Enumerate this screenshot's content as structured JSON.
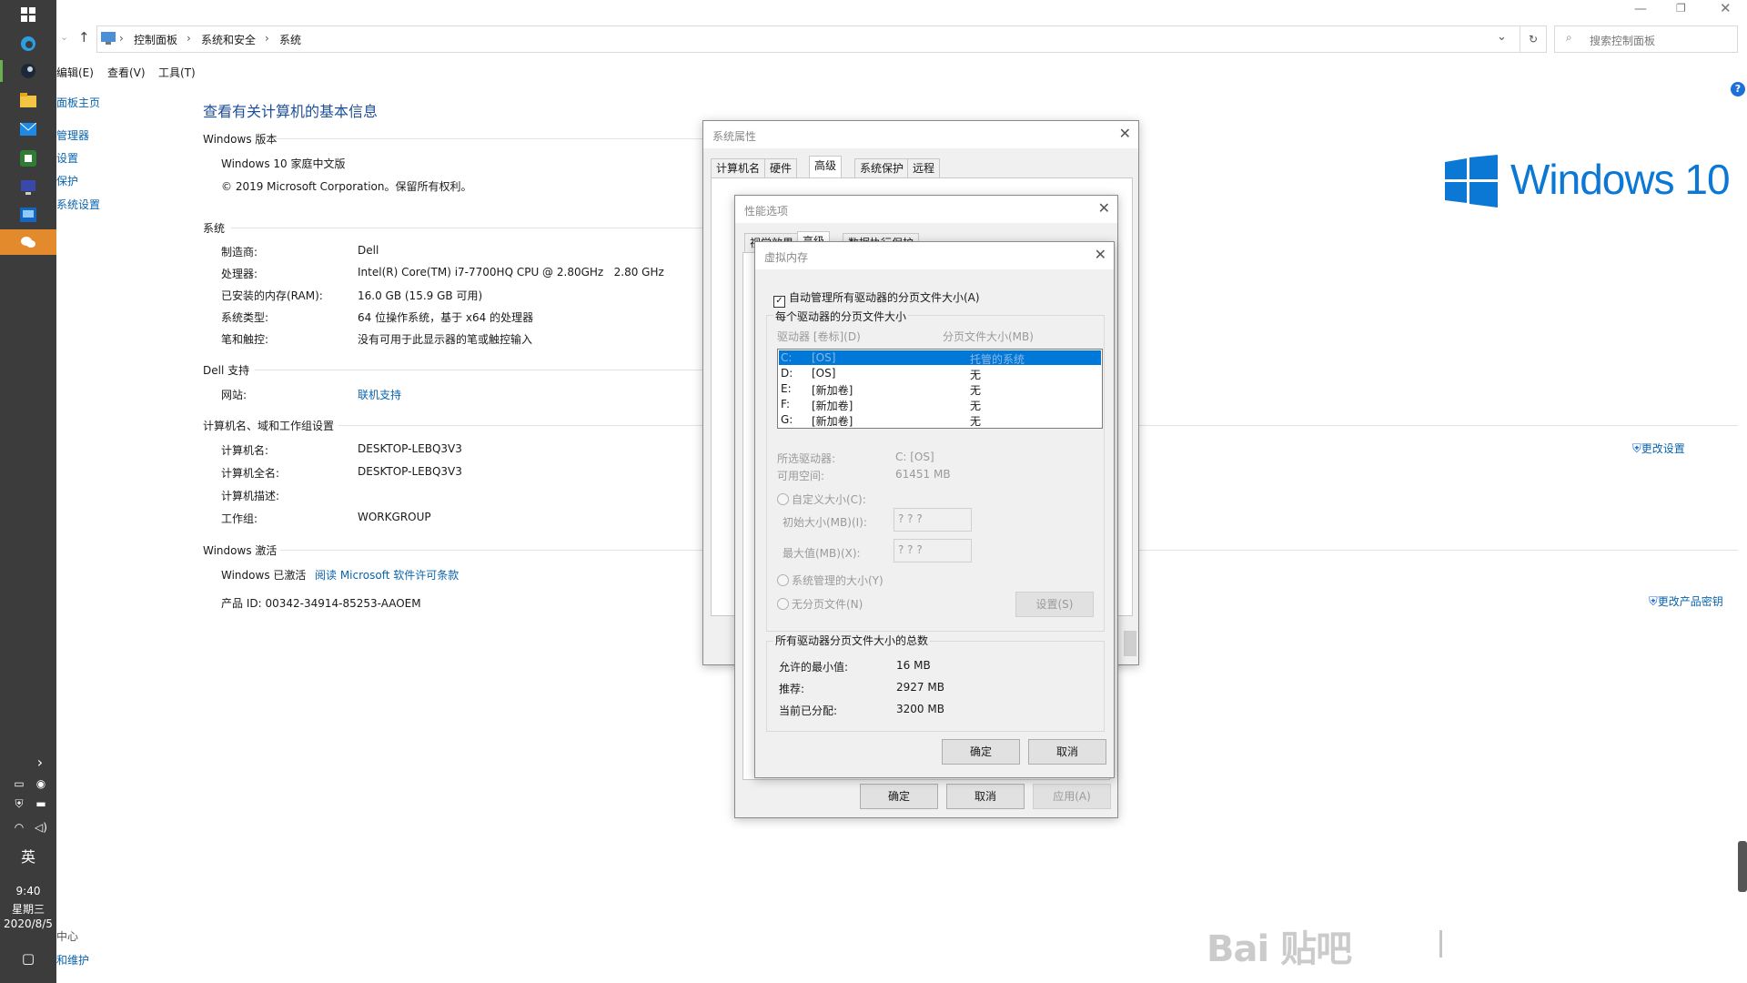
{
  "taskbar": {
    "lang": "英",
    "time": "9:40",
    "weekday": "星期三",
    "date": "2020/8/5"
  },
  "window": {
    "breadcrumb": [
      "控制面板",
      "系统和安全",
      "系统"
    ],
    "search_placeholder": "搜索控制面板",
    "menu": [
      "编辑(E)",
      "查看(V)",
      "工具(T)"
    ]
  },
  "left_nav": [
    "面板主页",
    "管理器",
    "设置",
    "保护",
    "系统设置"
  ],
  "left_nav_bottom": [
    "中心",
    "和维护"
  ],
  "main": {
    "title": "查看有关计算机的基本信息",
    "edition_section": "Windows 版本",
    "edition": "Windows 10 家庭中文版",
    "copyright": "© 2019 Microsoft Corporation。保留所有权利。",
    "system_section": "系统",
    "system": [
      {
        "label": "制造商:",
        "value": "Dell"
      },
      {
        "label": "处理器:",
        "value": "Intel(R) Core(TM) i7-7700HQ CPU @ 2.80GHz   2.80 GHz"
      },
      {
        "label": "已安装的内存(RAM):",
        "value": "16.0 GB (15.9 GB 可用)"
      },
      {
        "label": "系统类型:",
        "value": "64 位操作系统，基于 x64 的处理器"
      },
      {
        "label": "笔和触控:",
        "value": "没有可用于此显示器的笔或触控输入"
      }
    ],
    "support_section": "Dell 支持",
    "website_label": "网站:",
    "website_value": "联机支持",
    "computer_section": "计算机名、域和工作组设置",
    "computer": [
      {
        "label": "计算机名:",
        "value": "DESKTOP-LEBQ3V3"
      },
      {
        "label": "计算机全名:",
        "value": "DESKTOP-LEBQ3V3"
      },
      {
        "label": "计算机描述:",
        "value": ""
      },
      {
        "label": "工作组:",
        "value": "WORKGROUP"
      }
    ],
    "change_settings": "更改设置",
    "activation_section": "Windows 激活",
    "activated": "Windows 已激活",
    "license_link": "阅读 Microsoft 软件许可条款",
    "product_id": "产品 ID: 00342-34914-85253-AAOEM",
    "change_key": "更改产品密钥",
    "logo_text": "Windows 10"
  },
  "sys_props": {
    "title": "系统属性",
    "tabs": [
      "计算机名",
      "硬件",
      "高级",
      "系统保护",
      "远程"
    ],
    "selected_tab": "高级",
    "ok": "确定",
    "cancel": "取消",
    "apply": "应用(A)"
  },
  "perf": {
    "title": "性能选项",
    "tabs": [
      "视觉效果",
      "高级",
      "数据执行保护"
    ]
  },
  "vm": {
    "title": "虚拟内存",
    "auto_manage": "自动管理所有驱动器的分页文件大小(A)",
    "per_drive_section": "每个驱动器的分页文件大小",
    "col_drive": "驱动器 [卷标](D)",
    "col_size": "分页文件大小(MB)",
    "drives": [
      {
        "drive": "C:",
        "label": "[OS]",
        "size": "托管的系统",
        "selected": true
      },
      {
        "drive": "D:",
        "label": "[OS]",
        "size": "无"
      },
      {
        "drive": "E:",
        "label": "[新加卷]",
        "size": "无"
      },
      {
        "drive": "F:",
        "label": "[新加卷]",
        "size": "无"
      },
      {
        "drive": "G:",
        "label": "[新加卷]",
        "size": "无"
      }
    ],
    "selected_drive_label": "所选驱动器:",
    "selected_drive_value": "C:  [OS]",
    "free_space_label": "可用空间:",
    "free_space_value": "61451 MB",
    "custom_size": "自定义大小(C):",
    "initial_label": "初始大小(MB)(I):",
    "initial_value": "? ? ?",
    "max_label": "最大值(MB)(X):",
    "max_value": "? ? ?",
    "system_managed": "系统管理的大小(Y)",
    "no_paging": "无分页文件(N)",
    "set_button": "设置(S)",
    "total_section": "所有驱动器分页文件大小的总数",
    "min_label": "允许的最小值:",
    "min_value": "16 MB",
    "recommended_label": "推荐:",
    "recommended_value": "2927 MB",
    "allocated_label": "当前已分配:",
    "allocated_value": "3200 MB",
    "ok": "确定",
    "cancel": "取消"
  },
  "colors": {
    "accent": "#0078d7",
    "link": "#0a64ad",
    "taskbar": "#3c3c3c",
    "highlight": "#0078d7"
  },
  "watermark": "Bai 贴吧"
}
